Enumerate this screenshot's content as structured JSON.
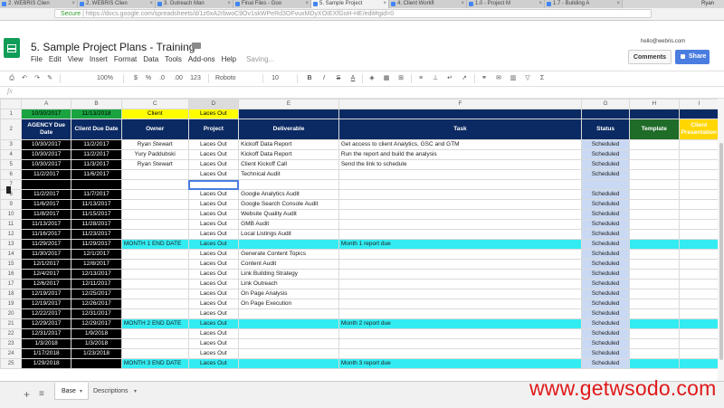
{
  "browser": {
    "tabs": [
      {
        "label": "2. WEBRIS Clien",
        "active": false
      },
      {
        "label": "2. WEBRIS Clien",
        "active": false
      },
      {
        "label": "3. Outreach Man",
        "active": false
      },
      {
        "label": "Final Files - Goo",
        "active": false
      },
      {
        "label": "5. Sample Project",
        "active": true
      },
      {
        "label": "4. Client Workfl",
        "active": false
      },
      {
        "label": "1.0 - Project M",
        "active": false
      },
      {
        "label": "1.7 - Building A",
        "active": false
      }
    ],
    "tab_close": "×",
    "user_label": "Ryan",
    "url_secure": "Secure",
    "url": "https://docs.google.com/spreadsheets/d/1z6xA2rbwoC9Ov1skWPeRd3OFvuxMDyXOIEXfGoH-HE/edit#gid=0"
  },
  "header": {
    "title": "5. Sample Project Plans - Training",
    "user_email": "hello@webris.com",
    "comments_label": "Comments",
    "share_label": "Share",
    "star_glyph": "☆"
  },
  "menu": [
    "File",
    "Edit",
    "View",
    "Insert",
    "Format",
    "Data",
    "Tools",
    "Add-ons",
    "Help"
  ],
  "saving_text": "Saving...",
  "toolbar": {
    "zoom": "100%",
    "currency": "$",
    "percent": "%",
    "dec_less": ".0",
    "dec_more": ".00",
    "num_format": "123",
    "font": "Roboto",
    "font_size": "10",
    "bold": "B",
    "italic": "I",
    "strike": "S",
    "text_color": "A"
  },
  "formula_bar": {
    "fx": "fx",
    "value": ""
  },
  "grid": {
    "col_headers": [
      "A",
      "B",
      "C",
      "D",
      "E",
      "F",
      "G",
      "H",
      "I"
    ],
    "row1": [
      "10/30/2017",
      "11/13/2018",
      "Client",
      "Laces Out"
    ],
    "row2": [
      "AGENCY Due Date",
      "Client Due Date",
      "Owner",
      "Project",
      "Deliverable",
      "Task",
      "Status",
      "Template",
      "Client Presentation"
    ],
    "rows": [
      {
        "n": "3",
        "a": "10/30/2017",
        "b": "11/2/2017",
        "c": "Ryan Stewart",
        "d": "Laces Out",
        "e": "Kickoff Data Report",
        "f": "Get access to client Analytics, GSC and GTM",
        "g": "Scheduled"
      },
      {
        "n": "4",
        "a": "10/30/2017",
        "b": "11/2/2017",
        "c": "Yury Paddubski",
        "d": "Laces Out",
        "e": "Kickoff Data Report",
        "f": "Run the report and build the analysis",
        "g": "Scheduled"
      },
      {
        "n": "5",
        "a": "10/30/2017",
        "b": "11/3/2017",
        "c": "Ryan Stewart",
        "d": "Laces Out",
        "e": "Client Kickoff Call",
        "f": "Send the link to schedule",
        "g": "Scheduled"
      },
      {
        "n": "6",
        "a": "11/2/2017",
        "b": "11/6/2017",
        "c": "",
        "d": "Laces Out",
        "e": "Technical Audit",
        "f": "",
        "g": "Scheduled"
      },
      {
        "n": "7",
        "a": "",
        "b": "",
        "c": "",
        "d": "",
        "e": "",
        "f": "",
        "g": "",
        "selected": true
      },
      {
        "n": "8",
        "a": "11/2/2017",
        "b": "11/7/2017",
        "c": "",
        "d": "Laces Out",
        "e": "Google Analytics Audit",
        "f": "",
        "g": "Scheduled"
      },
      {
        "n": "9",
        "a": "11/6/2017",
        "b": "11/13/2017",
        "c": "",
        "d": "Laces Out",
        "e": "Google Search Console Audit",
        "f": "",
        "g": "Scheduled"
      },
      {
        "n": "10",
        "a": "11/8/2017",
        "b": "11/15/2017",
        "c": "",
        "d": "Laces Out",
        "e": "Website Quality Audit",
        "f": "",
        "g": "Scheduled"
      },
      {
        "n": "11",
        "a": "11/13/2017",
        "b": "11/28/2017",
        "c": "",
        "d": "Laces Out",
        "e": "GMB Audit",
        "f": "",
        "g": "Scheduled"
      },
      {
        "n": "12",
        "a": "11/16/2017",
        "b": "11/23/2017",
        "c": "",
        "d": "Laces Out",
        "e": "Local Listings Audit",
        "f": "",
        "g": "Scheduled"
      },
      {
        "n": "13",
        "a": "11/29/2017",
        "b": "11/29/2017",
        "c": "MONTH 1 END DATE",
        "d": "Laces Out",
        "e": "",
        "f": "Month 1 report due",
        "g": "Scheduled",
        "month": true
      },
      {
        "n": "14",
        "a": "11/30/2017",
        "b": "12/1/2017",
        "c": "",
        "d": "Laces Out",
        "e": "Generate Content Topics",
        "f": "",
        "g": "Scheduled"
      },
      {
        "n": "15",
        "a": "12/1/2017",
        "b": "12/8/2017",
        "c": "",
        "d": "Laces Out",
        "e": "Content Audit",
        "f": "",
        "g": "Scheduled"
      },
      {
        "n": "16",
        "a": "12/4/2017",
        "b": "12/13/2017",
        "c": "",
        "d": "Laces Out",
        "e": "Link Building Strategy",
        "f": "",
        "g": "Scheduled"
      },
      {
        "n": "17",
        "a": "12/6/2017",
        "b": "12/11/2017",
        "c": "",
        "d": "Laces Out",
        "e": "Link Outreach",
        "f": "",
        "g": "Scheduled"
      },
      {
        "n": "18",
        "a": "12/19/2017",
        "b": "12/25/2017",
        "c": "",
        "d": "Laces Out",
        "e": "On Page Analysis",
        "f": "",
        "g": "Scheduled"
      },
      {
        "n": "19",
        "a": "12/19/2017",
        "b": "12/26/2017",
        "c": "",
        "d": "Laces Out",
        "e": "On Page Execution",
        "f": "",
        "g": "Scheduled"
      },
      {
        "n": "20",
        "a": "12/22/2017",
        "b": "12/31/2017",
        "c": "",
        "d": "Laces Out",
        "e": "",
        "f": "",
        "g": "Scheduled"
      },
      {
        "n": "21",
        "a": "12/29/2017",
        "b": "12/29/2017",
        "c": "MONTH 2 END DATE",
        "d": "Laces Out",
        "e": "",
        "f": "Month 2 report due",
        "g": "Scheduled",
        "month": true
      },
      {
        "n": "22",
        "a": "12/31/2017",
        "b": "1/9/2018",
        "c": "",
        "d": "Laces Out",
        "e": "",
        "f": "",
        "g": "Scheduled"
      },
      {
        "n": "23",
        "a": "1/3/2018",
        "b": "1/3/2018",
        "c": "",
        "d": "Laces Out",
        "e": "",
        "f": "",
        "g": "Scheduled"
      },
      {
        "n": "24",
        "a": "1/17/2018",
        "b": "1/23/2018",
        "c": "",
        "d": "Laces Out",
        "e": "",
        "f": "",
        "g": "Scheduled"
      },
      {
        "n": "25",
        "a": "1/29/2018",
        "b": "",
        "c": "MONTH 3 END DATE",
        "d": "Laces Out",
        "e": "",
        "f": "Month 3 report due",
        "g": "Scheduled",
        "month": true
      }
    ]
  },
  "sheet_tabs": {
    "add": "+",
    "list": "≡",
    "tabs": [
      "Base",
      "Descriptions"
    ],
    "arrow": "▾"
  },
  "watermark": "www.getwsodo.com",
  "colors": {
    "navy": "#0b2a63",
    "green": "#1aa341",
    "yellow": "#ffff00",
    "cyan": "#33ecf2",
    "status": "#c9d9f3",
    "share_blue": "#4a7de0",
    "watermark_red": "#e0191a"
  }
}
